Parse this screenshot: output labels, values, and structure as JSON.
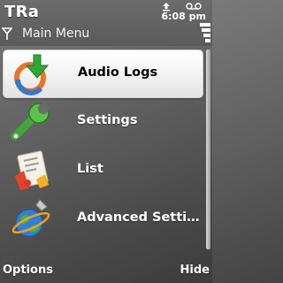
{
  "app": {
    "title": "TRa"
  },
  "header": {
    "screen_title": "Main Menu"
  },
  "status": {
    "time": "6:08 pm",
    "indicators": [
      "upload-icon",
      "voicemail-icon"
    ],
    "signal_icon": "antenna-icon"
  },
  "menu": {
    "selected_index": 0,
    "items": [
      {
        "label": "Audio Logs",
        "icon": "audio-logs-icon"
      },
      {
        "label": "Settings",
        "icon": "wrench-icon"
      },
      {
        "label": "List",
        "icon": "list-document-icon"
      },
      {
        "label": "Advanced Setti…",
        "icon": "globe-icon"
      }
    ]
  },
  "softkeys": {
    "left": "Options",
    "right": "Hide"
  },
  "colors": {
    "background": "#5e5e5e",
    "selection": "#ffffff",
    "text": "#ffffff",
    "selected_text": "#000000"
  }
}
